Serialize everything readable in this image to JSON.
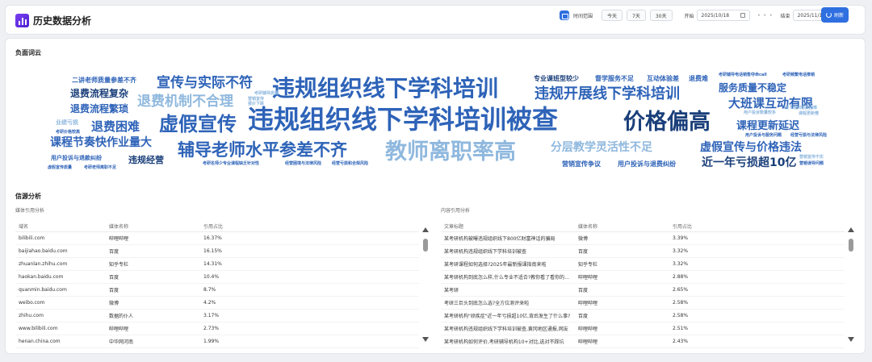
{
  "header": {
    "title": "历史数据分析",
    "range_label": "时间范围",
    "quick_ranges": [
      "今天",
      "7天",
      "30天"
    ],
    "start_label": "开始",
    "start_date": "2025/10/18",
    "end_label": "结束",
    "end_date": "2025/11/17",
    "query_button": "刷新"
  },
  "wordcloud": {
    "title": "负面词云",
    "words": [
      {
        "text": "违规组织线下学科培训被查",
        "color": "#2e63b8"
      },
      {
        "text": "违规组织线下学科培训",
        "color": "#2e63b8"
      },
      {
        "text": "教师离职率高",
        "color": "#8fb8de"
      },
      {
        "text": "价格偏高",
        "color": "#1a3f7a"
      },
      {
        "text": "虚假宣传",
        "color": "#2e63b8"
      },
      {
        "text": "辅导老师水平参差不齐",
        "color": "#2e63b8"
      },
      {
        "text": "违规开展线下学科培训",
        "color": "#2e63b8"
      },
      {
        "text": "宣传与实际不符",
        "color": "#2e63b8"
      },
      {
        "text": "退费机制不合理",
        "color": "#8fb8de"
      },
      {
        "text": "课程节奏快作业量大",
        "color": "#2e63b8"
      },
      {
        "text": "退费困难",
        "color": "#2e63b8"
      },
      {
        "text": "大班课互动有限",
        "color": "#2e63b8"
      },
      {
        "text": "虚假宣传与价格违法",
        "color": "#2e63b8"
      },
      {
        "text": "分层教学灵活性不足",
        "color": "#8fb8de"
      },
      {
        "text": "近一年亏损超10亿",
        "color": "#1a3f7a"
      },
      {
        "text": "课程更新延迟",
        "color": "#2e63b8"
      },
      {
        "text": "服务质量不稳定",
        "color": "#2e63b8"
      },
      {
        "text": "退费流程复杂",
        "color": "#1a3f7a"
      },
      {
        "text": "退费流程繁琐",
        "color": "#2e63b8"
      },
      {
        "text": "违规经营",
        "color": "#1a3f7a"
      },
      {
        "text": "二讲老师质量参差不齐",
        "color": "#2e63b8"
      },
      {
        "text": "专业课班型较少",
        "color": "#1a3f7a"
      },
      {
        "text": "督学服务不足",
        "color": "#2e63b8"
      },
      {
        "text": "互动体验差",
        "color": "#2e63b8"
      },
      {
        "text": "退费难",
        "color": "#2e63b8"
      },
      {
        "text": "用户投诉与退费纠纷",
        "color": "#2e63b8"
      },
      {
        "text": "营销宣传争议",
        "color": "#2e63b8"
      },
      {
        "text": "用户投诉与退款纠纷",
        "color": "#2e63b8"
      },
      {
        "text": "业绩亏损",
        "color": "#8fb8de"
      },
      {
        "text": "考研价格较高",
        "color": "#2e63b8"
      },
      {
        "text": "虚假宣传质量",
        "color": "#2e63b8"
      },
      {
        "text": "考研老师离职不足",
        "color": "#2e63b8"
      },
      {
        "text": "考研名师少专业课程缺乏针对性",
        "color": "#2e63b8"
      },
      {
        "text": "经营困境与法律风险",
        "color": "#2e63b8"
      },
      {
        "text": "经营亏损和合规风险",
        "color": "#2e63b8"
      },
      {
        "text": "考研辅导质量",
        "color": "#8fb8de"
      },
      {
        "text": "营销宣传",
        "color": "#8fb8de"
      },
      {
        "text": "报价下跌",
        "color": "#8fb8de"
      },
      {
        "text": "考研辅导电话销售夺命call",
        "color": "#2e63b8"
      },
      {
        "text": "考研频繁电话推销",
        "color": "#2e63b8"
      },
      {
        "text": "用户投诉数量较多",
        "color": "#8fb8de"
      },
      {
        "text": "线下培训退费困难",
        "color": "#8fb8de"
      },
      {
        "text": "课程更新慢",
        "color": "#8fb8de"
      },
      {
        "text": "用户投诉与服务问题",
        "color": "#2e63b8"
      },
      {
        "text": "经营亏损与法律风险",
        "color": "#2e63b8"
      },
      {
        "text": "营销宣传不实",
        "color": "#8fb8de"
      },
      {
        "text": "营销误导问题",
        "color": "#2e63b8"
      }
    ]
  },
  "source": {
    "title": "信源分析",
    "media": {
      "subtitle": "媒体引用分析",
      "columns": [
        "域名",
        "媒体名称",
        "引用占比"
      ],
      "rows": [
        [
          "bilibili.com",
          "哔哩哔哩",
          "16.37%"
        ],
        [
          "baijiahao.baidu.com",
          "百度",
          "16.15%"
        ],
        [
          "zhuanlan.zhihu.com",
          "知乎专栏",
          "14.31%"
        ],
        [
          "haokan.baidu.com",
          "百度",
          "10.4%"
        ],
        [
          "quanmin.baidu.com",
          "百度",
          "8.7%"
        ],
        [
          "weibo.com",
          "微博",
          "4.2%"
        ],
        [
          "zhihu.com",
          "数据的仆人",
          "3.17%"
        ],
        [
          "www.bilibili.com",
          "哔哩哔哩",
          "2.73%"
        ],
        [
          "henan.china.com",
          "中华网河南",
          "1.99%"
        ]
      ]
    },
    "content": {
      "subtitle": "内容引用分析",
      "columns": [
        "文章标题",
        "媒体名称",
        "引用占比"
      ],
      "rows": [
        [
          "某考研机构被曝违规组织线下800亿财富神话的骗局",
          "微博",
          "3.39%"
        ],
        [
          "某考研机构违规组织线下学科培训被查",
          "百度",
          "3.32%"
        ],
        [
          "某考研课程如何选择?2025年最新报课指南来啦",
          "知乎专栏",
          "3.32%"
        ],
        [
          "某考研机构到底怎么样,什么专业不适合?教你看了看你的满意度",
          "哔哩哔哩",
          "2.88%"
        ],
        [
          "某考研",
          "百度",
          "2.65%"
        ],
        [
          "考研三巨头到底怎么选?全方位测评来啦",
          "哔哩哔哩",
          "2.58%"
        ],
        [
          "某考研机构\"顽疾症\"近一年亏损超10亿,背后发生了什么事?",
          "百度",
          "2.58%"
        ],
        [
          "某考研机构违规组织线下学科培训被查,黄冈地区通报,网友",
          "哔哩哔哩",
          "2.51%"
        ],
        [
          "某考研机构如何评价,考研辅导机构10+对比,选对不踩坑",
          "哔哩哔哩",
          "2.43%"
        ]
      ]
    }
  }
}
